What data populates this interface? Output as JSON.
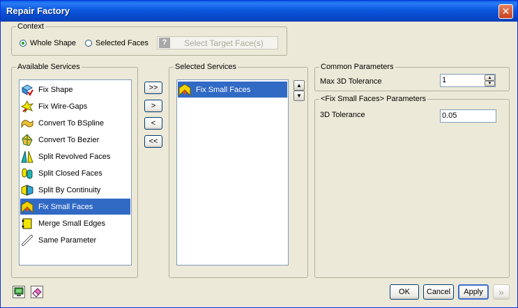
{
  "window": {
    "title": "Repair Factory",
    "close_glyph": "✕"
  },
  "context": {
    "legend": "Context",
    "whole_shape": "Whole Shape",
    "selected_faces": "Selected Faces",
    "selected_option": "Whole Shape",
    "select_target_button": "Select Target Face(s)",
    "help_glyph": "?"
  },
  "available": {
    "legend": "Available Services",
    "items": [
      {
        "label": "Fix Shape",
        "icon": "fix-shape-icon"
      },
      {
        "label": "Fix Wire-Gaps",
        "icon": "fix-wire-gaps-icon"
      },
      {
        "label": "Convert To BSpline",
        "icon": "convert-bspline-icon"
      },
      {
        "label": "Convert To Bezier",
        "icon": "convert-bezier-icon"
      },
      {
        "label": "Split Revolved Faces",
        "icon": "split-revolved-icon"
      },
      {
        "label": "Split Closed Faces",
        "icon": "split-closed-icon"
      },
      {
        "label": "Split By Continuity",
        "icon": "split-continuity-icon"
      },
      {
        "label": "Fix Small Faces",
        "icon": "fix-small-faces-icon"
      },
      {
        "label": "Merge Small Edges",
        "icon": "merge-small-edges-icon"
      },
      {
        "label": "Same Parameter",
        "icon": "same-parameter-icon"
      }
    ],
    "selected_index": 7
  },
  "transfer": {
    "add_all": ">>",
    "add": ">",
    "remove": "<",
    "remove_all": "<<"
  },
  "selected_services": {
    "legend": "Selected Services",
    "items": [
      {
        "label": "Fix Small Faces",
        "icon": "fix-small-faces-icon"
      }
    ],
    "up_glyph": "▲",
    "down_glyph": "▼"
  },
  "common": {
    "legend": "Common Parameters",
    "max_tol_label": "Max 3D Tolerance",
    "max_tol_value": "1"
  },
  "params": {
    "legend": "<Fix Small Faces> Parameters",
    "tol_label": "3D Tolerance",
    "tol_value": "0.05"
  },
  "footer": {
    "ok": "OK",
    "cancel": "Cancel",
    "apply": "Apply",
    "next_glyph": "»"
  },
  "colors": {
    "window_bg": "#ECE9D8",
    "selection": "#316AC5",
    "title_blue": "#0B58DE"
  }
}
